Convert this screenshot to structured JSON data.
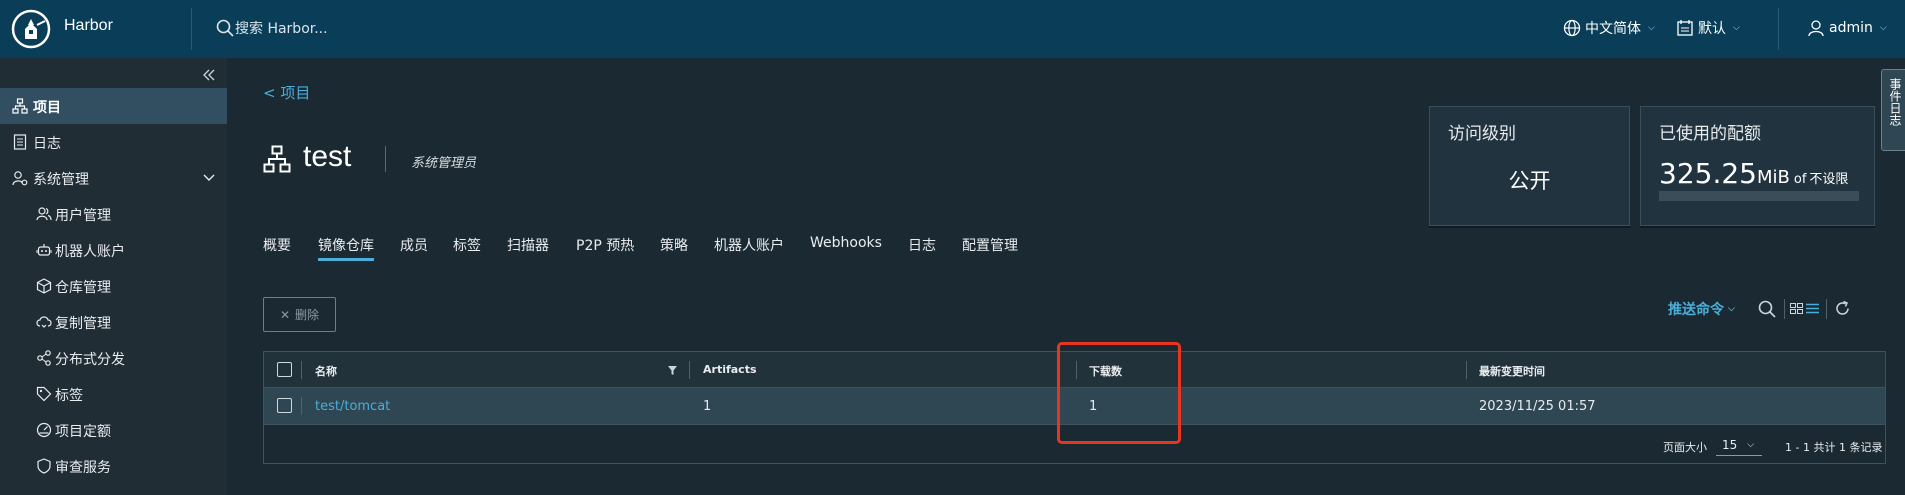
{
  "header": {
    "brand": "Harbor",
    "search_placeholder": "搜索 Harbor...",
    "language": "中文简体",
    "theme": "默认",
    "user": "admin"
  },
  "sidebar": {
    "items": [
      {
        "label": "项目",
        "active": true,
        "icon": "project-icon"
      },
      {
        "label": "日志",
        "icon": "log-icon"
      },
      {
        "label": "系统管理",
        "icon": "system-admin-icon",
        "expanded": true
      },
      {
        "label": "用户管理",
        "icon": "users-icon"
      },
      {
        "label": "机器人账户",
        "icon": "robot-icon"
      },
      {
        "label": "仓库管理",
        "icon": "registry-icon"
      },
      {
        "label": "复制管理",
        "icon": "replication-icon"
      },
      {
        "label": "分布式分发",
        "icon": "distribution-icon"
      },
      {
        "label": "标签",
        "icon": "tag-icon"
      },
      {
        "label": "项目定额",
        "icon": "quota-icon"
      },
      {
        "label": "审查服务",
        "icon": "shield-icon"
      }
    ]
  },
  "project": {
    "back_label": "< 项目",
    "name": "test",
    "role": "系统管理员"
  },
  "cards": {
    "access_title": "访问级别",
    "access_value": "公开",
    "quota_title": "已使用的配额",
    "quota_value": "325.25",
    "quota_unit": "MiB",
    "quota_of": "of",
    "quota_limit": "不设限"
  },
  "tabs": [
    "概要",
    "镜像仓库",
    "成员",
    "标签",
    "扫描器",
    "P2P 预热",
    "策略",
    "机器人账户",
    "Webhooks",
    "日志",
    "配置管理"
  ],
  "toolbar": {
    "delete_label": "删除",
    "push_command_label": "推送命令"
  },
  "table": {
    "columns": [
      "名称",
      "Artifacts",
      "下载数",
      "最新变更时间"
    ],
    "rows": [
      {
        "name": "test/tomcat",
        "artifacts": "1",
        "pulls": "1",
        "updated": "2023/11/25 01:57"
      }
    ],
    "page_size_label": "页面大小",
    "page_size": "15",
    "summary": "1 - 1 共计 1 条记录"
  },
  "side_tab": "事件日志",
  "colors": {
    "header_bg": "#0a3e58",
    "accent": "#4aaed9",
    "highlight": "#e8351f"
  }
}
